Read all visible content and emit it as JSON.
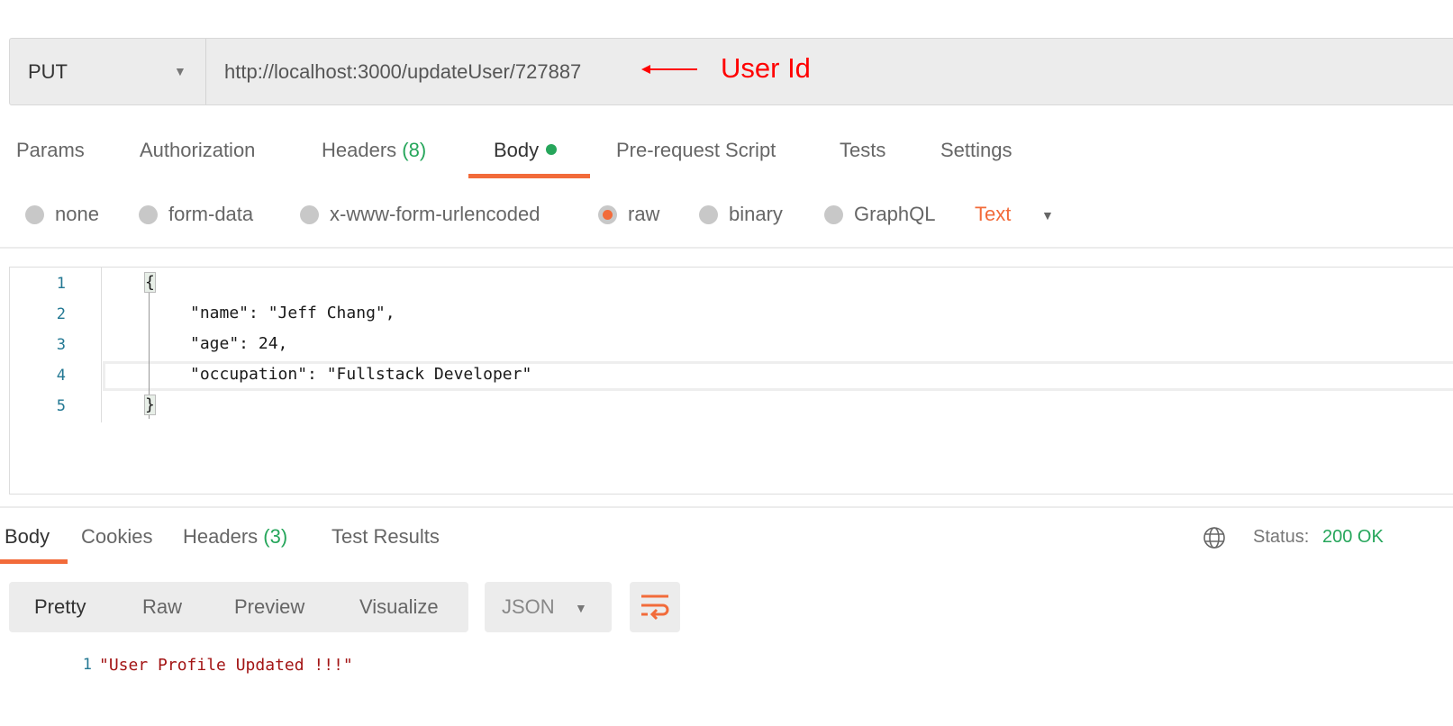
{
  "request": {
    "method": "PUT",
    "url": "http://localhost:3000/updateUser/727887",
    "annotation": "User Id"
  },
  "request_tabs": [
    {
      "label": "Params"
    },
    {
      "label": "Authorization"
    },
    {
      "label": "Headers",
      "count": "(8)"
    },
    {
      "label": "Body",
      "active": true
    },
    {
      "label": "Pre-request Script"
    },
    {
      "label": "Tests"
    },
    {
      "label": "Settings"
    }
  ],
  "body_types": [
    {
      "label": "none"
    },
    {
      "label": "form-data"
    },
    {
      "label": "x-www-form-urlencoded"
    },
    {
      "label": "raw",
      "selected": true
    },
    {
      "label": "binary"
    },
    {
      "label": "GraphQL"
    }
  ],
  "raw_format": "Text",
  "editor": {
    "line_numbers": [
      "1",
      "2",
      "3",
      "4",
      "5"
    ],
    "lines": [
      "{",
      "\"name\": \"Jeff Chang\",",
      "\"age\": 24,",
      "\"occupation\": \"Fullstack Developer\"",
      "}"
    ]
  },
  "response_tabs": [
    {
      "label": "Body",
      "active": true
    },
    {
      "label": "Cookies"
    },
    {
      "label": "Headers",
      "count": "(3)"
    },
    {
      "label": "Test Results"
    }
  ],
  "status": {
    "label": "Status:",
    "value": "200 OK"
  },
  "view_modes": [
    "Pretty",
    "Raw",
    "Preview",
    "Visualize"
  ],
  "response_format": "JSON",
  "response": {
    "line_number": "1",
    "text": "\"User Profile Updated !!!\""
  },
  "colors": {
    "accent": "#f26b3a",
    "success": "#26a65b",
    "annotation": "#ff0000"
  }
}
